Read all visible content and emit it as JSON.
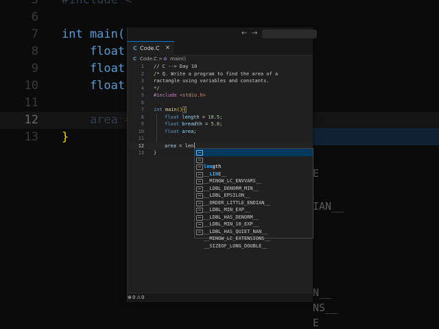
{
  "background_editor": {
    "lines": [
      {
        "num": "5",
        "code": "#include <"
      },
      {
        "num": "6",
        "code": ""
      },
      {
        "num": "7",
        "code": "int main()"
      },
      {
        "num": "8",
        "code": "    float"
      },
      {
        "num": "9",
        "code": "    float"
      },
      {
        "num": "10",
        "code": "    float"
      },
      {
        "num": "11",
        "code": ""
      },
      {
        "num": "12",
        "code": "    area ="
      },
      {
        "num": "13",
        "code": "}"
      }
    ],
    "right_fragments": [
      "E",
      "IAN__",
      "N__",
      "NS__",
      "E"
    ]
  },
  "titlebar": {
    "back_icon": "←",
    "forward_icon": "→"
  },
  "tab": {
    "icon": "C",
    "name": "Code.C",
    "close": "✕"
  },
  "breadcrumb": {
    "file_icon": "C",
    "file": "Code.C",
    "sep": ">",
    "symbol_icon": "⊛",
    "symbol": "main()"
  },
  "editor": {
    "lines": [
      {
        "num": "1",
        "html_key": "l1",
        "text": "// C --> Day 10"
      },
      {
        "num": "2",
        "html_key": "l2",
        "text": "/* Q. Write a program to find the area of a"
      },
      {
        "num": "3",
        "html_key": "l3",
        "text": "ractangle using variables and constants."
      },
      {
        "num": "4",
        "html_key": "l4",
        "text": "*/"
      },
      {
        "num": "5",
        "html_key": "l5",
        "text": "#include <stdio.h>"
      },
      {
        "num": "6",
        "html_key": "l6",
        "text": ""
      },
      {
        "num": "7",
        "html_key": "l7",
        "text": "int main(){"
      },
      {
        "num": "8",
        "html_key": "l8",
        "text": "float length = 10.5;"
      },
      {
        "num": "9",
        "html_key": "l9",
        "text": "float breadth = 5.0;"
      },
      {
        "num": "10",
        "html_key": "l10",
        "text": "float area;"
      },
      {
        "num": "11",
        "html_key": "l11",
        "text": ""
      },
      {
        "num": "12",
        "html_key": "l12",
        "text": "area = len"
      },
      {
        "num": "13",
        "html_key": "l13",
        "text": "}"
      }
    ],
    "current_line": "12"
  },
  "suggestions": [
    {
      "prefix": "",
      "match": "len",
      "rest": "gth"
    },
    {
      "prefix": "__",
      "match": "L",
      "rest": "I",
      "rest2": "N",
      "tail": "E__"
    },
    {
      "label": "__MINGW_LC_ENVVARS__"
    },
    {
      "label": "__LDBL_DENORM_MIN__"
    },
    {
      "label": "__LDBL_EPSILON__"
    },
    {
      "label": "__ORDER_LITTLE_ENDIAN__"
    },
    {
      "label": "__LDBL_MIN_EXP__"
    },
    {
      "label": "__LDBL_HAS_DENORM__"
    },
    {
      "label": "__LDBL_MIN_10_EXP__"
    },
    {
      "label": "__LDBL_HAS_QUIET_NAN__"
    },
    {
      "label": "__MINGW_LC_EXTENSIONS__"
    },
    {
      "label": "__SIZEOF_LONG_DOUBLE__"
    }
  ],
  "statusbar": {
    "errors_icon": "⊗",
    "errors": "0",
    "warnings_icon": "⚠",
    "warnings": "0"
  }
}
